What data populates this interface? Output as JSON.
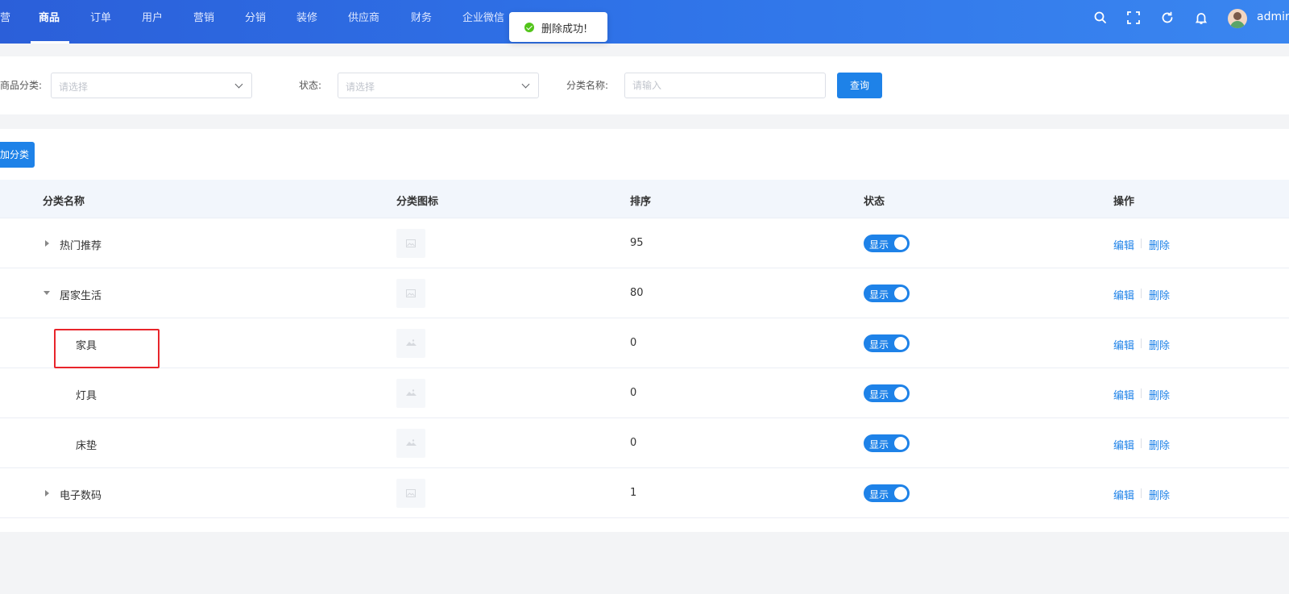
{
  "nav": {
    "items": [
      {
        "label": "营"
      },
      {
        "label": "商品"
      },
      {
        "label": "订单"
      },
      {
        "label": "用户"
      },
      {
        "label": "营销"
      },
      {
        "label": "分销"
      },
      {
        "label": "装修"
      },
      {
        "label": "供应商"
      },
      {
        "label": "财务"
      },
      {
        "label": "企业微信"
      }
    ],
    "active_index": 1,
    "icons": [
      "search-icon",
      "fullscreen-icon",
      "refresh-icon",
      "bell-icon"
    ],
    "user_name": "admin"
  },
  "toast": {
    "text": "删除成功!",
    "status_color": "#52c41a"
  },
  "filters": {
    "category_label": "商品分类:",
    "category_placeholder": "请选择",
    "status_label": "状态:",
    "status_placeholder": "请选择",
    "name_label": "分类名称:",
    "name_placeholder": "请输入",
    "query_button": "查询"
  },
  "toolbar": {
    "add_button": "加分类"
  },
  "table": {
    "headers": {
      "name": "分类名称",
      "icon": "分类图标",
      "sort": "排序",
      "status": "状态",
      "actions": "操作"
    },
    "rows": [
      {
        "name": "热门推荐",
        "sort": "95",
        "status": "显示",
        "expand": "collapsed",
        "level": 0
      },
      {
        "name": "居家生活",
        "sort": "80",
        "status": "显示",
        "expand": "expanded",
        "level": 0
      },
      {
        "name": "家具",
        "sort": "0",
        "status": "显示",
        "expand": "none",
        "level": 1
      },
      {
        "name": "灯具",
        "sort": "0",
        "status": "显示",
        "expand": "none",
        "level": 1
      },
      {
        "name": "床垫",
        "sort": "0",
        "status": "显示",
        "expand": "none",
        "level": 1
      },
      {
        "name": "电子数码",
        "sort": "1",
        "status": "显示",
        "expand": "collapsed",
        "level": 0
      }
    ],
    "edit_label": "编辑",
    "delete_label": "删除"
  },
  "colors": {
    "primary": "#1e82e8",
    "highlight": "#e8252b",
    "nav_bg": "#2f73e8"
  }
}
